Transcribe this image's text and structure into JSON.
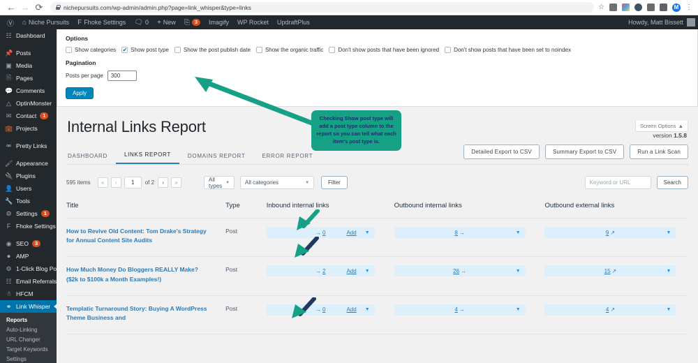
{
  "browser": {
    "url": "nichepursuits.com/wp-admin/admin.php?page=link_whisper&type=links",
    "back_icon": "back-arrow-icon",
    "forward_icon": "forward-arrow-icon",
    "reload_icon": "reload-icon",
    "lock_icon": "lock-icon",
    "star_icon": "star-icon",
    "profile_initial": "M",
    "menu_icon": "kebab-menu-icon"
  },
  "adminbar": {
    "logo": "wordpress-logo-icon",
    "site_name": "Niche Pursuits",
    "fhoke": "Fhoke Settings",
    "comments_count": "0",
    "new_label": "New",
    "updates_count": "3",
    "imagify": "Imagify",
    "wp_rocket": "WP Rocket",
    "updraftplus": "UpdraftPlus",
    "howdy": "Howdy, Matt Bissett"
  },
  "sidebar": {
    "items": [
      {
        "label": "Dashboard",
        "icon": "dashboard-icon",
        "badge": null
      },
      {
        "label": "Posts",
        "icon": "pin-icon",
        "badge": null
      },
      {
        "label": "Media",
        "icon": "media-icon",
        "badge": null
      },
      {
        "label": "Pages",
        "icon": "pages-icon",
        "badge": null
      },
      {
        "label": "Comments",
        "icon": "comments-icon",
        "badge": null
      },
      {
        "label": "OptinMonster",
        "icon": "optinmonster-icon",
        "badge": null
      },
      {
        "label": "Contact",
        "icon": "envelope-icon",
        "badge": "1"
      },
      {
        "label": "Projects",
        "icon": "portfolio-icon",
        "badge": null
      },
      {
        "label": "Pretty Links",
        "icon": "link-icon",
        "badge": null
      },
      {
        "label": "Appearance",
        "icon": "brush-icon",
        "badge": null
      },
      {
        "label": "Plugins",
        "icon": "plugins-icon",
        "badge": null
      },
      {
        "label": "Users",
        "icon": "users-icon",
        "badge": null
      },
      {
        "label": "Tools",
        "icon": "tools-icon",
        "badge": null
      },
      {
        "label": "Settings",
        "icon": "gear-icon",
        "badge": "1"
      },
      {
        "label": "Fhoke Settings",
        "icon": "f-letter-icon",
        "badge": null
      },
      {
        "label": "SEO",
        "icon": "seo-icon",
        "badge": "3"
      },
      {
        "label": "AMP",
        "icon": "amp-icon",
        "badge": null
      },
      {
        "label": "1-Click Blog Post",
        "icon": "gear-icon",
        "badge": null
      },
      {
        "label": "Email Referrals",
        "icon": "network-icon",
        "badge": null
      },
      {
        "label": "HFCM",
        "icon": "hfcm-icon",
        "badge": null
      },
      {
        "label": "Link Whisper",
        "icon": "link-whisper-icon",
        "badge": null,
        "active": true
      }
    ],
    "submenu": [
      {
        "label": "Reports",
        "current": true
      },
      {
        "label": "Auto-Linking",
        "current": false
      },
      {
        "label": "URL Changer",
        "current": false
      },
      {
        "label": "Target Keywords",
        "current": false
      },
      {
        "label": "Settings",
        "current": false
      }
    ]
  },
  "screen_options": {
    "tab_label": "Screen Options",
    "tab_icon": "chevron-up-icon",
    "options_label": "Options",
    "checkboxes": [
      {
        "label": "Show categories",
        "checked": false
      },
      {
        "label": "Show post type",
        "checked": true
      },
      {
        "label": "Show the post publish date",
        "checked": false
      },
      {
        "label": "Show the organic traffic",
        "checked": false
      },
      {
        "label": "Don't show posts that have been ignored",
        "checked": false
      },
      {
        "label": "Don't show posts that have been set to noindex",
        "checked": false
      }
    ],
    "pagination_label": "Pagination",
    "posts_per_page_label": "Posts per page",
    "posts_per_page_value": "300",
    "apply_label": "Apply"
  },
  "callout": {
    "text": "Checking Show post type will add a post type column to the report so you can tell what each item's post type is.",
    "bg_color": "#16a085",
    "text_color": "#1a2f6e"
  },
  "page": {
    "title": "Internal Links Report",
    "version_prefix": "version ",
    "version_number": "1.5.8"
  },
  "tabs": [
    {
      "label": "DASHBOARD",
      "active": false
    },
    {
      "label": "LINKS REPORT",
      "active": true
    },
    {
      "label": "DOMAINS REPORT",
      "active": false
    },
    {
      "label": "ERROR REPORT",
      "active": false
    }
  ],
  "action_buttons": [
    {
      "label": "Detailed Export to CSV"
    },
    {
      "label": "Summary Export to CSV"
    },
    {
      "label": "Run a Link Scan"
    }
  ],
  "toolbar": {
    "items_count": "595 items",
    "first_page_icon": "double-left-chevron-icon",
    "prev_page_icon": "left-chevron-icon",
    "page_value": "1",
    "of_total": "of 2",
    "next_page_icon": "right-chevron-icon",
    "last_page_icon": "double-right-chevron-icon",
    "type_filter": "All types",
    "category_filter": "All categories",
    "filter_label": "Filter",
    "search_placeholder": "Keyword or URL",
    "search_value": "",
    "search_label": "Search"
  },
  "table": {
    "headers": [
      "Title",
      "Type",
      "Inbound internal links",
      "Outbound internal links",
      "Outbound external links"
    ],
    "add_label": "Add",
    "rows": [
      {
        "title": "How to Revive Old Content: Tom Drake's Strategy for Annual Content Site Audits",
        "type": "Post",
        "inbound": "0",
        "outbound_internal": "8",
        "outbound_external": "9"
      },
      {
        "title": "How Much Money Do Bloggers REALLY Make? ($2k to $100k a Month Examples!)",
        "type": "Post",
        "inbound": "2",
        "outbound_internal": "26",
        "outbound_external": "15"
      },
      {
        "title": "Templatic Turnaround Story: Buying A WordPress Theme Business and",
        "type": "Post",
        "inbound": "0",
        "outbound_internal": "4",
        "outbound_external": "4"
      }
    ]
  }
}
